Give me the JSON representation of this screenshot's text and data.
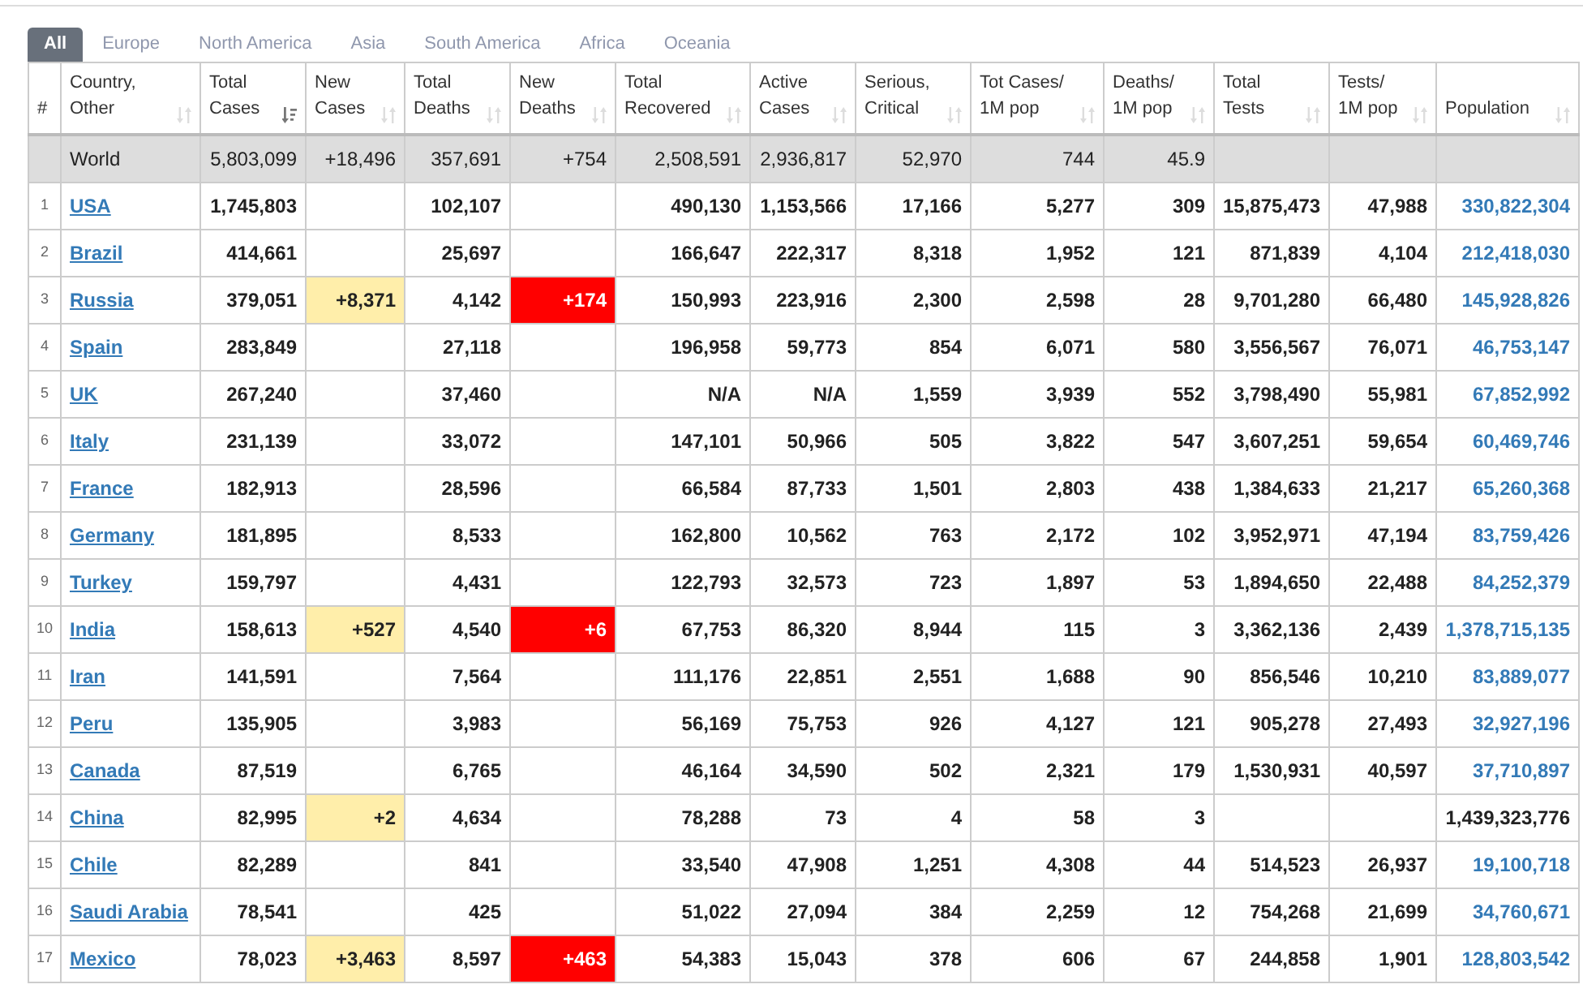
{
  "region_tabs": [
    {
      "label": "All",
      "selected": true
    },
    {
      "label": "Europe",
      "selected": false
    },
    {
      "label": "North America",
      "selected": false
    },
    {
      "label": "Asia",
      "selected": false
    },
    {
      "label": "South America",
      "selected": false
    },
    {
      "label": "Africa",
      "selected": false
    },
    {
      "label": "Oceania",
      "selected": false
    }
  ],
  "columns": [
    {
      "lines": [
        "#"
      ],
      "sortable": false,
      "sorted": false
    },
    {
      "lines": [
        "Country,",
        "Other"
      ],
      "sortable": true,
      "sorted": false
    },
    {
      "lines": [
        "Total",
        "Cases"
      ],
      "sortable": true,
      "sorted": true
    },
    {
      "lines": [
        "New",
        "Cases"
      ],
      "sortable": true,
      "sorted": false,
      "kind": "new_cases"
    },
    {
      "lines": [
        "Total",
        "Deaths"
      ],
      "sortable": true,
      "sorted": false
    },
    {
      "lines": [
        "New",
        "Deaths"
      ],
      "sortable": true,
      "sorted": false,
      "kind": "new_deaths"
    },
    {
      "lines": [
        "Total",
        "Recovered"
      ],
      "sortable": true,
      "sorted": false
    },
    {
      "lines": [
        "Active",
        "Cases"
      ],
      "sortable": true,
      "sorted": false
    },
    {
      "lines": [
        "Serious,",
        "Critical"
      ],
      "sortable": true,
      "sorted": false
    },
    {
      "lines": [
        "Tot Cases/",
        "1M pop"
      ],
      "sortable": true,
      "sorted": false
    },
    {
      "lines": [
        "Deaths/",
        "1M pop"
      ],
      "sortable": true,
      "sorted": false
    },
    {
      "lines": [
        "Total",
        "Tests"
      ],
      "sortable": true,
      "sorted": false
    },
    {
      "lines": [
        "Tests/",
        "1M pop"
      ],
      "sortable": true,
      "sorted": false
    },
    {
      "lines": [
        "Population"
      ],
      "sortable": true,
      "sorted": false
    }
  ],
  "world_row": {
    "country": "World",
    "cells": [
      "5,803,099",
      "+18,496",
      "357,691",
      "+754",
      "2,508,591",
      "2,936,817",
      "52,970",
      "744",
      "45.9",
      null,
      null,
      null
    ]
  },
  "rows": [
    {
      "rank": "1",
      "country": "USA",
      "population_linked": true,
      "cells": [
        "1,745,803",
        null,
        "102,107",
        null,
        "490,130",
        "1,153,566",
        "17,166",
        "5,277",
        "309",
        "15,875,473",
        "47,988",
        "330,822,304"
      ]
    },
    {
      "rank": "2",
      "country": "Brazil",
      "population_linked": true,
      "cells": [
        "414,661",
        null,
        "25,697",
        null,
        "166,647",
        "222,317",
        "8,318",
        "1,952",
        "121",
        "871,839",
        "4,104",
        "212,418,030"
      ]
    },
    {
      "rank": "3",
      "country": "Russia",
      "population_linked": true,
      "cells": [
        "379,051",
        "+8,371",
        "4,142",
        "+174",
        "150,993",
        "223,916",
        "2,300",
        "2,598",
        "28",
        "9,701,280",
        "66,480",
        "145,928,826"
      ]
    },
    {
      "rank": "4",
      "country": "Spain",
      "population_linked": true,
      "cells": [
        "283,849",
        null,
        "27,118",
        null,
        "196,958",
        "59,773",
        "854",
        "6,071",
        "580",
        "3,556,567",
        "76,071",
        "46,753,147"
      ]
    },
    {
      "rank": "5",
      "country": "UK",
      "population_linked": true,
      "cells": [
        "267,240",
        null,
        "37,460",
        null,
        "N/A",
        "N/A",
        "1,559",
        "3,939",
        "552",
        "3,798,490",
        "55,981",
        "67,852,992"
      ]
    },
    {
      "rank": "6",
      "country": "Italy",
      "population_linked": true,
      "cells": [
        "231,139",
        null,
        "33,072",
        null,
        "147,101",
        "50,966",
        "505",
        "3,822",
        "547",
        "3,607,251",
        "59,654",
        "60,469,746"
      ]
    },
    {
      "rank": "7",
      "country": "France",
      "population_linked": true,
      "cells": [
        "182,913",
        null,
        "28,596",
        null,
        "66,584",
        "87,733",
        "1,501",
        "2,803",
        "438",
        "1,384,633",
        "21,217",
        "65,260,368"
      ]
    },
    {
      "rank": "8",
      "country": "Germany",
      "population_linked": true,
      "cells": [
        "181,895",
        null,
        "8,533",
        null,
        "162,800",
        "10,562",
        "763",
        "2,172",
        "102",
        "3,952,971",
        "47,194",
        "83,759,426"
      ]
    },
    {
      "rank": "9",
      "country": "Turkey",
      "population_linked": true,
      "cells": [
        "159,797",
        null,
        "4,431",
        null,
        "122,793",
        "32,573",
        "723",
        "1,897",
        "53",
        "1,894,650",
        "22,488",
        "84,252,379"
      ]
    },
    {
      "rank": "10",
      "country": "India",
      "population_linked": true,
      "cells": [
        "158,613",
        "+527",
        "4,540",
        "+6",
        "67,753",
        "86,320",
        "8,944",
        "115",
        "3",
        "3,362,136",
        "2,439",
        "1,378,715,135"
      ]
    },
    {
      "rank": "11",
      "country": "Iran",
      "population_linked": true,
      "cells": [
        "141,591",
        null,
        "7,564",
        null,
        "111,176",
        "22,851",
        "2,551",
        "1,688",
        "90",
        "856,546",
        "10,210",
        "83,889,077"
      ]
    },
    {
      "rank": "12",
      "country": "Peru",
      "population_linked": true,
      "cells": [
        "135,905",
        null,
        "3,983",
        null,
        "56,169",
        "75,753",
        "926",
        "4,127",
        "121",
        "905,278",
        "27,493",
        "32,927,196"
      ]
    },
    {
      "rank": "13",
      "country": "Canada",
      "population_linked": true,
      "cells": [
        "87,519",
        null,
        "6,765",
        null,
        "46,164",
        "34,590",
        "502",
        "2,321",
        "179",
        "1,530,931",
        "40,597",
        "37,710,897"
      ]
    },
    {
      "rank": "14",
      "country": "China",
      "population_linked": false,
      "cells": [
        "82,995",
        "+2",
        "4,634",
        null,
        "78,288",
        "73",
        "4",
        "58",
        "3",
        null,
        null,
        "1,439,323,776"
      ]
    },
    {
      "rank": "15",
      "country": "Chile",
      "population_linked": true,
      "cells": [
        "82,289",
        null,
        "841",
        null,
        "33,540",
        "47,908",
        "1,251",
        "4,308",
        "44",
        "514,523",
        "26,937",
        "19,100,718"
      ]
    },
    {
      "rank": "16",
      "country": "Saudi Arabia",
      "population_linked": true,
      "cells": [
        "78,541",
        null,
        "425",
        null,
        "51,022",
        "27,094",
        "384",
        "2,259",
        "12",
        "754,268",
        "21,699",
        "34,760,671"
      ]
    },
    {
      "rank": "17",
      "country": "Mexico",
      "population_linked": true,
      "cells": [
        "78,023",
        "+3,463",
        "8,597",
        "+463",
        "54,383",
        "15,043",
        "378",
        "606",
        "67",
        "244,858",
        "1,901",
        "128,803,542"
      ]
    }
  ]
}
